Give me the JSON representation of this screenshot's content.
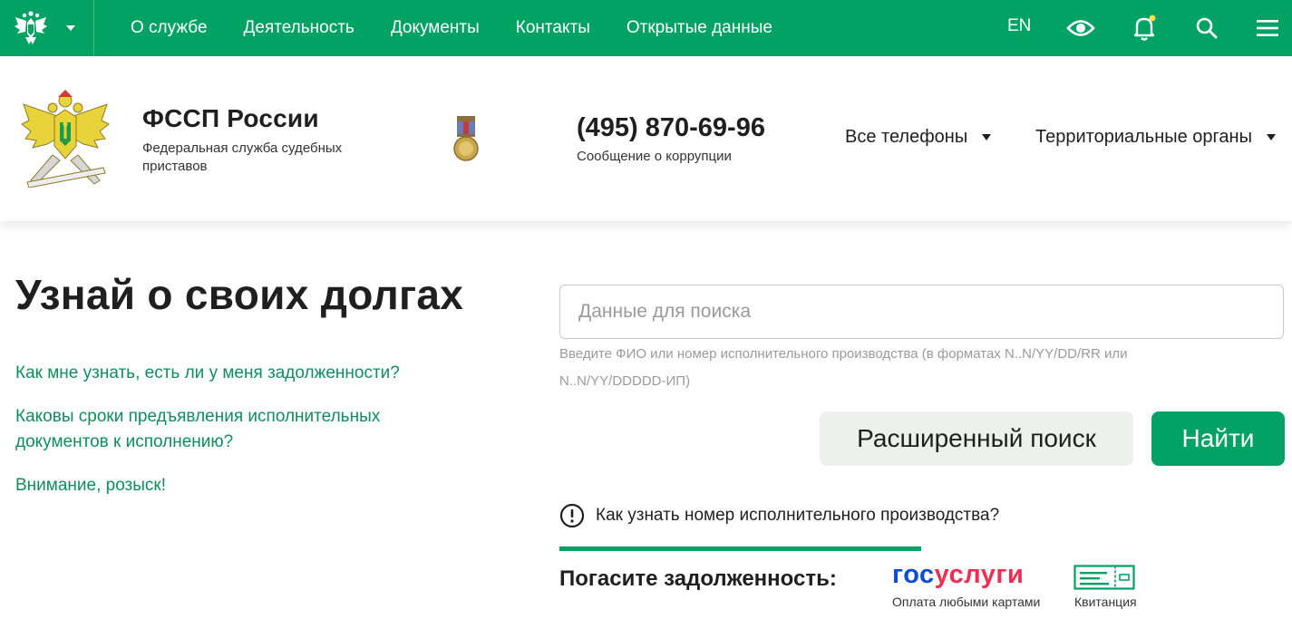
{
  "topbar": {
    "nav": [
      "О службе",
      "Деятельность",
      "Документы",
      "Контакты",
      "Открытые данные"
    ],
    "lang": "EN",
    "icons": [
      "eye-icon",
      "bell-icon",
      "search-icon",
      "menu-icon"
    ],
    "bell_dot_color": "#f7e34a"
  },
  "header": {
    "title": "ФССП России",
    "subtitle": "Федеральная служба судебных приставов",
    "phone": "(495) 870-69-96",
    "phone_caption": "Сообщение о коррупции",
    "dropdown_phones": "Все телефоны",
    "dropdown_territorial": "Территориальные органы"
  },
  "main": {
    "headline": "Узнай о своих долгах",
    "faq": [
      "Как мне узнать, есть ли у меня задолженности?",
      "Каковы сроки предъявления исполнительных документов к исполнению?",
      "Внимание, розыск!"
    ],
    "search_placeholder": "Данные для поиска",
    "search_value": "",
    "hint": "Введите ФИО или номер исполнительного производства (в форматах N..N/YY/DD/RR или N..N/YY/DDDDD-ИП)",
    "advanced_button": "Расширенный поиск",
    "find_button": "Найти",
    "how_to": "Как узнать номер исполнительного производства?"
  },
  "payment": {
    "title": "Погасите задолженность:",
    "gos_logo_part1": "гос",
    "gos_logo_part2": "услуги",
    "gos_caption": "Оплата любыми картами",
    "receipt_caption": "Квитанция"
  },
  "colors": {
    "brand_green": "#02a164",
    "link_green": "#0f8d5c",
    "gos_blue": "#0d4cd3",
    "gos_red": "#ee2f53"
  }
}
